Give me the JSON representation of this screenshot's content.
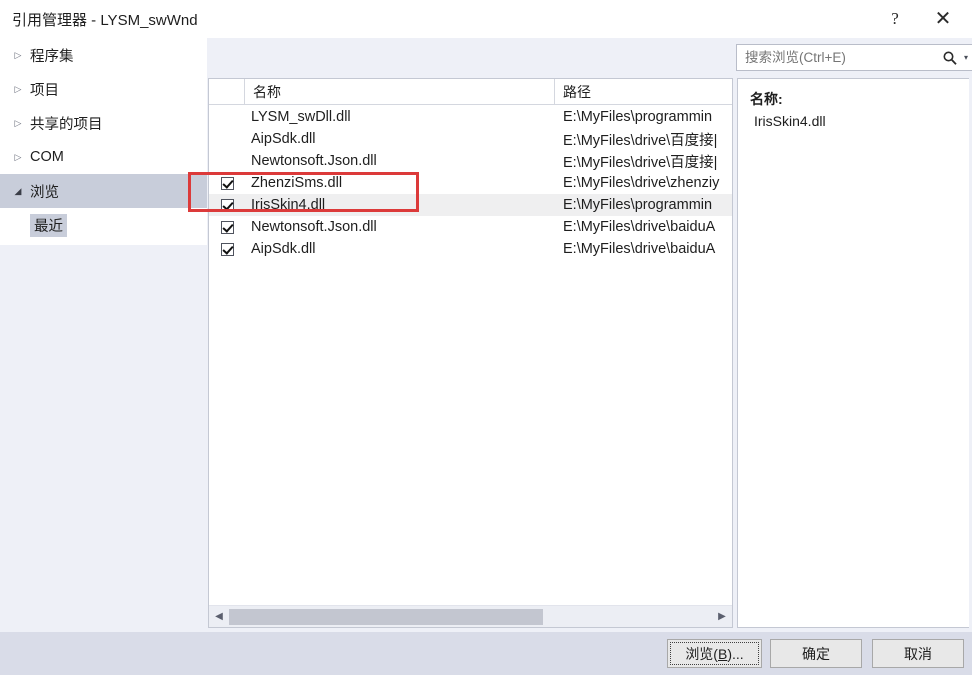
{
  "window": {
    "title": "引用管理器 - LYSM_swWnd",
    "help_icon": "question-mark-icon",
    "close_icon": "close-icon"
  },
  "sidebar": {
    "items": [
      {
        "label": "程序集",
        "arrow": "▷",
        "expanded": false,
        "selected": false
      },
      {
        "label": "项目",
        "arrow": "▷",
        "expanded": false,
        "selected": false
      },
      {
        "label": "共享的项目",
        "arrow": "▷",
        "expanded": false,
        "selected": false
      },
      {
        "label": "COM",
        "arrow": "▷",
        "expanded": false,
        "selected": false
      },
      {
        "label": "浏览",
        "arrow": "◢",
        "expanded": true,
        "selected": true
      }
    ],
    "child": {
      "label": "最近",
      "selected": true
    }
  },
  "search": {
    "placeholder": "搜索浏览(Ctrl+E)",
    "value": "",
    "icon": "search-icon",
    "caret": "▾"
  },
  "list": {
    "columns": [
      "",
      "名称",
      "路径"
    ],
    "rows": [
      {
        "checked": false,
        "show_checkbox": false,
        "name": "LYSM_swDll.dll",
        "path": "E:\\MyFiles\\programmin",
        "selected": false
      },
      {
        "checked": false,
        "show_checkbox": false,
        "name": "AipSdk.dll",
        "path": "E:\\MyFiles\\drive\\百度接|",
        "selected": false
      },
      {
        "checked": false,
        "show_checkbox": false,
        "name": "Newtonsoft.Json.dll",
        "path": "E:\\MyFiles\\drive\\百度接|",
        "selected": false
      },
      {
        "checked": true,
        "show_checkbox": true,
        "name": "ZhenziSms.dll",
        "path": "E:\\MyFiles\\drive\\zhenziy",
        "selected": false
      },
      {
        "checked": true,
        "show_checkbox": true,
        "name": "IrisSkin4.dll",
        "path": "E:\\MyFiles\\programmin",
        "selected": true
      },
      {
        "checked": true,
        "show_checkbox": true,
        "name": "Newtonsoft.Json.dll",
        "path": "E:\\MyFiles\\drive\\baiduA",
        "selected": false
      },
      {
        "checked": true,
        "show_checkbox": true,
        "name": "AipSdk.dll",
        "path": "E:\\MyFiles\\drive\\baiduA",
        "selected": false
      }
    ],
    "scrollbar": {
      "left_arrow": "◀",
      "right_arrow": "▶",
      "thumb_percent": 65
    }
  },
  "details": {
    "label": "名称:",
    "value": "IrisSkin4.dll"
  },
  "footer": {
    "browse_pre": "浏览(",
    "browse_mnemonic": "B",
    "browse_post": ")...",
    "ok_label": "确定",
    "cancel_label": "取消"
  },
  "annotation": {
    "color": "#dc3a3a",
    "shape": "rectangle"
  }
}
